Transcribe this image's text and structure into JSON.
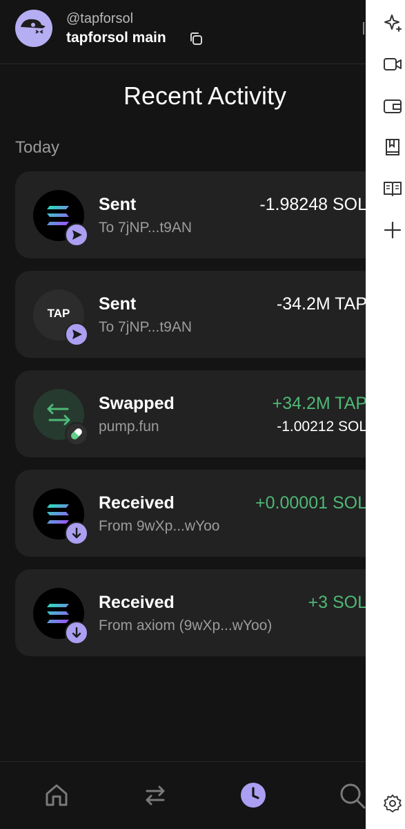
{
  "header": {
    "handle": "@tapforsol",
    "account_name": "tapforsol main"
  },
  "page": {
    "title": "Recent Activity",
    "section": "Today"
  },
  "activities": [
    {
      "title": "Sent",
      "subtitle": "To 7jNP...t9AN",
      "amount": "-1.98248 SOL",
      "amount_secondary": "",
      "token": "SOL",
      "badge": "send-arrow"
    },
    {
      "title": "Sent",
      "subtitle": "To 7jNP...t9AN",
      "amount": "-34.2M TAP",
      "amount_secondary": "",
      "token": "TAP",
      "badge": "send-arrow"
    },
    {
      "title": "Swapped",
      "subtitle": "pump.fun",
      "amount": "+34.2M TAP",
      "amount_secondary": "-1.00212 SOL",
      "token": "swap",
      "badge": "pill"
    },
    {
      "title": "Received",
      "subtitle": "From 9wXp...wYoo",
      "amount": "+0.00001 SOL",
      "amount_secondary": "",
      "token": "SOL",
      "badge": "receive-arrow"
    },
    {
      "title": "Received",
      "subtitle": "From axiom (9wXp...wYoo)",
      "amount": "+3 SOL",
      "amount_secondary": "",
      "token": "SOL",
      "badge": "receive-arrow"
    }
  ],
  "colors": {
    "accent": "#ab9ff2",
    "positive": "#4fb876",
    "card": "#222222",
    "background": "#141414"
  },
  "nav": [
    "home-icon",
    "swap-icon",
    "history-icon",
    "search-icon"
  ],
  "sidebar": [
    "sparkle-icon",
    "video-icon",
    "wallet-icon",
    "bookmark-book-icon",
    "reader-icon",
    "plus-icon",
    "settings-icon"
  ]
}
